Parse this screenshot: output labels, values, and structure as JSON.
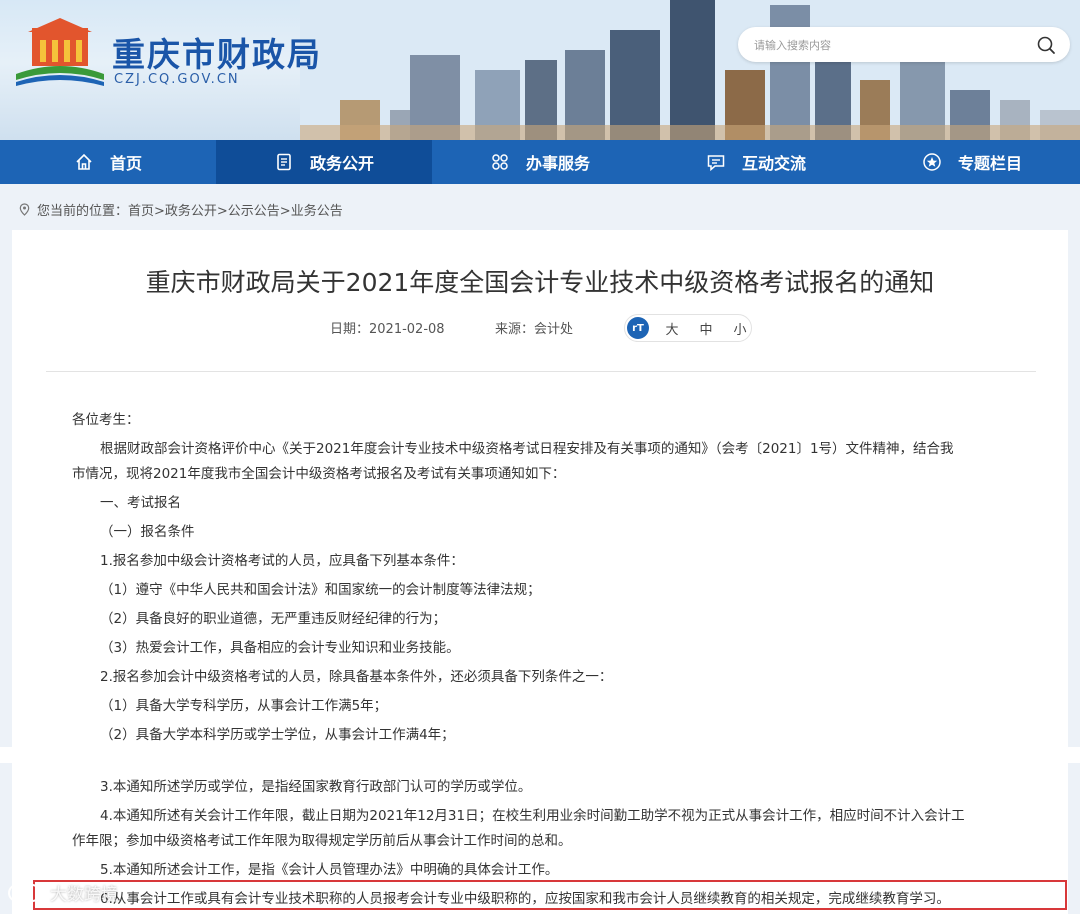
{
  "header": {
    "site_title": "重庆市财政局",
    "site_domain": "CZJ.CQ.GOV.CN",
    "search_placeholder": "请输入搜索内容"
  },
  "nav": {
    "items": [
      {
        "label": "首页",
        "icon": "home-icon"
      },
      {
        "label": "政务公开",
        "icon": "document-icon"
      },
      {
        "label": "办事服务",
        "icon": "grid-icon"
      },
      {
        "label": "互动交流",
        "icon": "chat-icon"
      },
      {
        "label": "专题栏目",
        "icon": "star-icon"
      }
    ],
    "active_index": 1
  },
  "breadcrumb": {
    "icon": "location-pin-icon",
    "prefix": "您当前的位置：",
    "path": "首页>政务公开>公示公告>业务公告"
  },
  "article": {
    "title": "重庆市财政局关于2021年度全国会计专业技术中级资格考试报名的通知",
    "date_label": "日期：",
    "date": "2021-02-08",
    "source_label": "来源：",
    "source": "会计处",
    "font_badge": "rT",
    "font_sizes": [
      "大",
      "中",
      "小"
    ],
    "lines": [
      "各位考生：",
      "根据财政部会计资格评价中心《关于2021年度会计专业技术中级资格考试日程安排及有关事项的通知》（会考〔2021〕1号）文件精神，结合我",
      "市情况，现将2021年度我市全国会计中级资格考试报名及考试有关事项通知如下：",
      "一、考试报名",
      "（一）报名条件",
      "1.报名参加中级会计资格考试的人员，应具备下列基本条件：",
      "（1）遵守《中华人民共和国会计法》和国家统一的会计制度等法律法规；",
      "（2）具备良好的职业道德，无严重违反财经纪律的行为；",
      "（3）热爱会计工作，具备相应的会计专业知识和业务技能。",
      "2.报名参加会计中级资格考试的人员，除具备基本条件外，还必须具备下列条件之一：",
      "（1）具备大学专科学历，从事会计工作满5年；",
      "（2）具备大学本科学历或学士学位，从事会计工作满4年；",
      "3.本通知所述学历或学位，是指经国家教育行政部门认可的学历或学位。",
      "4.本通知所述有关会计工作年限，截止日期为2021年12月31日；在校生利用业余时间勤工助学不视为正式从事会计工作，相应时间不计入会计工",
      "作年限；参加中级资格考试工作年限为取得规定学历前后从事会计工作时间的总和。",
      "5.本通知所述会计工作，是指《会计人员管理办法》中明确的具体会计工作。",
      "6.从事会计工作或具有会计专业技术职称的人员报考会计专业中级职称的，应按国家和我市会计人员继续教育的相关规定，完成继续教育学习。"
    ]
  },
  "watermark": {
    "text": "大数跨境"
  },
  "colors": {
    "nav_bg": "#1d64b5",
    "nav_active": "#0f4d98",
    "title_blue": "#1a55a8",
    "highlight_red": "#d8383a"
  }
}
